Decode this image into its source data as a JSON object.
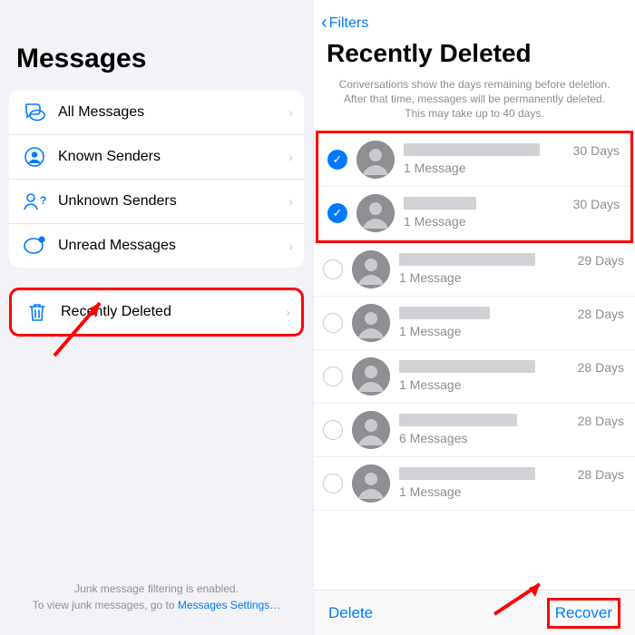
{
  "left": {
    "title": "Messages",
    "filters": [
      {
        "label": "All Messages",
        "icon": "chat-bubbles"
      },
      {
        "label": "Known Senders",
        "icon": "person-circle"
      },
      {
        "label": "Unknown Senders",
        "icon": "person-question"
      },
      {
        "label": "Unread Messages",
        "icon": "unread-bubble"
      }
    ],
    "deleted": {
      "label": "Recently Deleted",
      "icon": "trash"
    },
    "footer_line1": "Junk message filtering is enabled.",
    "footer_line2": "To view junk messages, go to ",
    "footer_link": "Messages Settings…"
  },
  "right": {
    "back_label": "Filters",
    "title": "Recently Deleted",
    "note": "Conversations show the days remaining before deletion. After that time, messages will be permanently deleted. This may take up to 40 days.",
    "rows": [
      {
        "selected": true,
        "days": "30 Days",
        "count": "1 Message",
        "name_w": 150
      },
      {
        "selected": true,
        "days": "30 Days",
        "count": "1 Message",
        "name_w": 80
      },
      {
        "selected": false,
        "days": "29 Days",
        "count": "1 Message",
        "name_w": 150
      },
      {
        "selected": false,
        "days": "28 Days",
        "count": "1 Message",
        "name_w": 100
      },
      {
        "selected": false,
        "days": "28 Days",
        "count": "1 Message",
        "name_w": 150
      },
      {
        "selected": false,
        "days": "28 Days",
        "count": "6 Messages",
        "name_w": 130
      },
      {
        "selected": false,
        "days": "28 Days",
        "count": "1 Message",
        "name_w": 150
      }
    ],
    "delete_label": "Delete",
    "recover_label": "Recover"
  }
}
